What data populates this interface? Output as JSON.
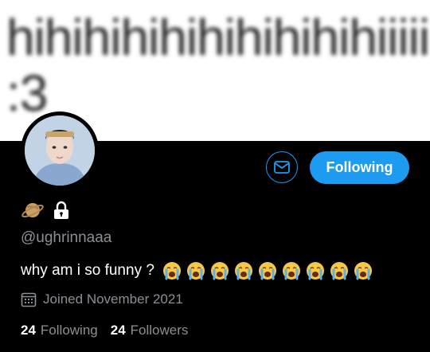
{
  "banner": {
    "text": "hihihihihihihihihihiiiii :3"
  },
  "profile": {
    "handle": "@ughrinnaaa",
    "bio_text": "why am i so funny ?",
    "bio_emoji_count": 9,
    "bio_emoji": "loudly-crying-face",
    "joined": "Joined November 2021",
    "name_icons": [
      "ringed-planet",
      "lock"
    ]
  },
  "actions": {
    "follow_label": "Following"
  },
  "stats": {
    "following_count": "24",
    "following_label": "Following",
    "followers_count": "24",
    "followers_label": "Followers"
  },
  "colors": {
    "accent": "#1d9bf0",
    "muted": "#8b8f94",
    "background": "#000000"
  }
}
